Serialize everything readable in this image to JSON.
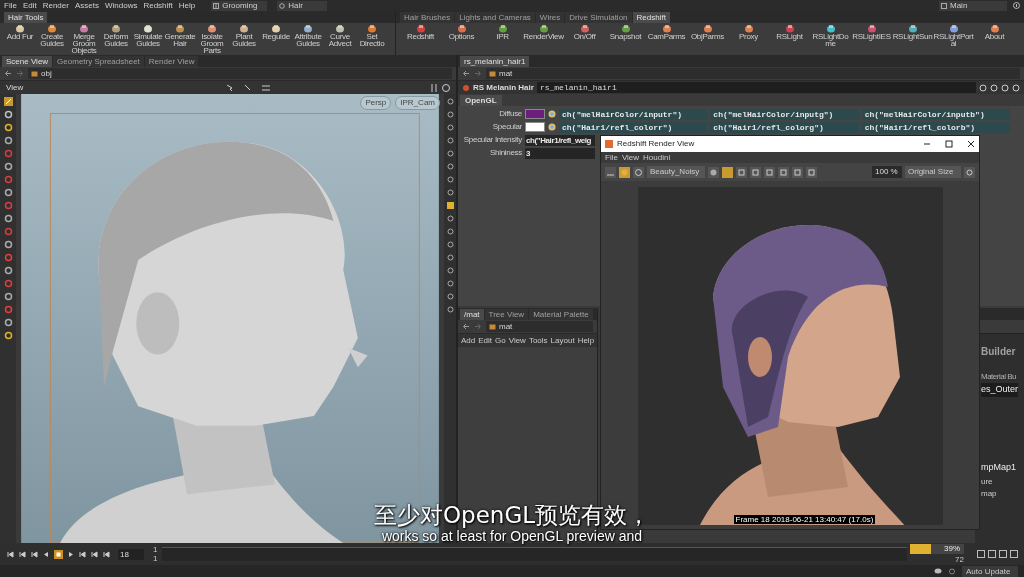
{
  "menu": [
    "File",
    "Edit",
    "Render",
    "Assets",
    "Windows",
    "Redshift",
    "Help"
  ],
  "desktop": "Grooming",
  "context": "Hair",
  "main_desktop": "Main",
  "shelf_left": {
    "tabs": [
      {
        "label": "Hair Tools",
        "selected": true
      }
    ],
    "tools": [
      "Add Fur",
      "Create Guides",
      "Merge Groom Objects",
      "Deform Guides",
      "Simulate Guides",
      "Generate Hair",
      "Isolate Groom Parts",
      "Plant Guides",
      "Reguide",
      "Attribute Guides",
      "Curve Advect",
      "Set Directio"
    ]
  },
  "shelf_right": {
    "tabs": [
      {
        "label": "Hair Brushes",
        "selected": false
      },
      {
        "label": "Lights and Cameras",
        "selected": false
      },
      {
        "label": "Wires",
        "selected": false
      },
      {
        "label": "Drive Simulation",
        "selected": false
      },
      {
        "label": "Redshift",
        "selected": true
      }
    ],
    "tools": [
      "Redshift",
      "Options",
      "IPR",
      "RenderView",
      "On/Off",
      "Snapshot",
      "CamParms",
      "ObjParms",
      "Proxy",
      "RSLight",
      "RSLightDome",
      "RSLightIES",
      "RSLightSun",
      "RSLightPortal",
      "About"
    ]
  },
  "scene_pane": {
    "tabs": [
      {
        "label": "Scene View",
        "selected": true
      },
      {
        "label": "Geometry Spreadsheet",
        "selected": false
      },
      {
        "label": "Render View",
        "selected": false
      }
    ],
    "path": "obj",
    "title": "View",
    "badges": [
      "Persp",
      "IPR_Cam"
    ]
  },
  "param_pane": {
    "tabs": [
      {
        "label": "rs_melanin_hair1",
        "selected": true
      }
    ],
    "path": "mat",
    "node_type": "RS Melanin Hair",
    "node_name": "rs_melanin_hair1",
    "sub_tabs": [
      {
        "label": "OpenGL",
        "selected": true
      }
    ],
    "params": [
      {
        "label": "Diffuse",
        "color": "#6b1f7d",
        "values": [
          "ch(\"melHairColor/inputr\")",
          "ch(\"melHairColor/inputg\")",
          "ch(\"melHairColor/inputb\")"
        ]
      },
      {
        "label": "Specular",
        "color": "#ffffff",
        "values": [
          "ch(\"Hair1/refl_colorr\")",
          "ch(\"Hair1/refl_colorg\")",
          "ch(\"Hair1/refl_colorb\")"
        ]
      },
      {
        "label": "Specular Intensity",
        "values": [
          "ch(\"Hair1/refl_weig"
        ]
      },
      {
        "label": "Shininess",
        "values": [
          "3"
        ]
      }
    ]
  },
  "network_pane": {
    "tabs": [
      {
        "label": "/mat",
        "selected": true
      },
      {
        "label": "Tree View",
        "selected": false
      },
      {
        "label": "Material Palette",
        "selected": false
      }
    ],
    "path": "mat",
    "menu": [
      "Add",
      "Edit",
      "Go",
      "View",
      "Tools",
      "Layout",
      "Help"
    ]
  },
  "side_pane": {
    "texts": [
      "Builder",
      "Material Bu",
      "es_Outer",
      "mpMap1",
      "ure",
      "map"
    ]
  },
  "render_view": {
    "title": "Redshift Render View",
    "menu": [
      "File",
      "View",
      "Houdini"
    ],
    "aov": "Beauty_Noisy",
    "zoom": "100 %",
    "size": "Original Size",
    "footer": "Frame 18  2018-06-21 13:40:47 (17.0s)"
  },
  "timeline": {
    "frame": "18",
    "start": [
      "1",
      "1"
    ],
    "end": "72",
    "progress": {
      "level": 0.39,
      "reading": "39%"
    }
  },
  "status_bar": {
    "update_mode": "Auto Update"
  },
  "subtitles": [
    "至少对OpenGL预览有效，",
    "works so at least for OpenGL preview and"
  ]
}
